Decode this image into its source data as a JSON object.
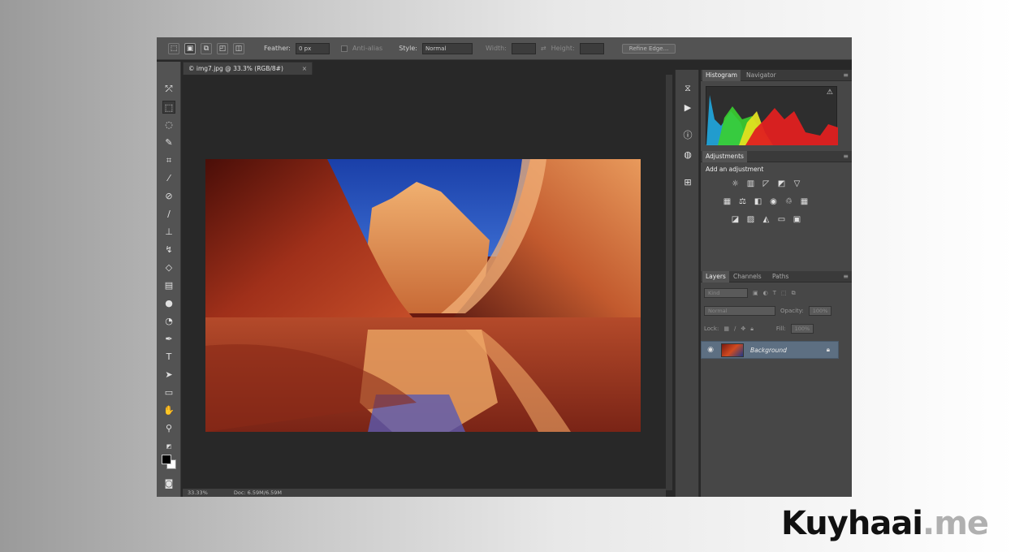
{
  "options_bar": {
    "feather_label": "Feather:",
    "feather_value": "0 px",
    "antialias_label": "Anti-alias",
    "style_label": "Style:",
    "style_value": "Normal",
    "width_label": "Width:",
    "height_label": "Height:",
    "refine_label": "Refine Edge..."
  },
  "document": {
    "tab_title": "© img7.jpg @ 33.3% (RGB/8#)",
    "tab_close": "×",
    "zoom": "33.33%",
    "doc_info": "Doc: 6.59M/6.59M"
  },
  "panels": {
    "histogram_tab": "Histogram",
    "navigator_tab": "Navigator",
    "adjustments_tab": "Adjustments",
    "adjustments_title": "Add an adjustment",
    "layers_tab": "Layers",
    "channels_tab": "Channels",
    "paths_tab": "Paths",
    "kind_label": "Kind",
    "blend_mode": "Normal",
    "opacity_label": "Opacity:",
    "opacity_value": "100%",
    "lock_label": "Lock:",
    "fill_label": "Fill:",
    "fill_value": "100%",
    "layer_name": "Background"
  },
  "watermark": {
    "main": "Kuyhaai",
    "suffix": ".me"
  },
  "icons": {
    "tools": [
      "move-icon",
      "marquee-icon",
      "lasso-icon",
      "quick-select-icon",
      "crop-icon",
      "eyedropper-icon",
      "healing-brush-icon",
      "brush-icon",
      "clone-stamp-icon",
      "history-brush-icon",
      "eraser-icon",
      "gradient-icon",
      "blur-icon",
      "dodge-icon",
      "pen-icon",
      "type-icon",
      "path-select-icon",
      "shape-icon",
      "hand-icon",
      "zoom-icon"
    ],
    "dock": [
      "history-icon",
      "actions-icon",
      "info-icon",
      "properties-icon"
    ]
  },
  "colors": {
    "selected_layer": "#5d6f82",
    "app_bg": "#282828",
    "panel_bg": "#474747"
  }
}
